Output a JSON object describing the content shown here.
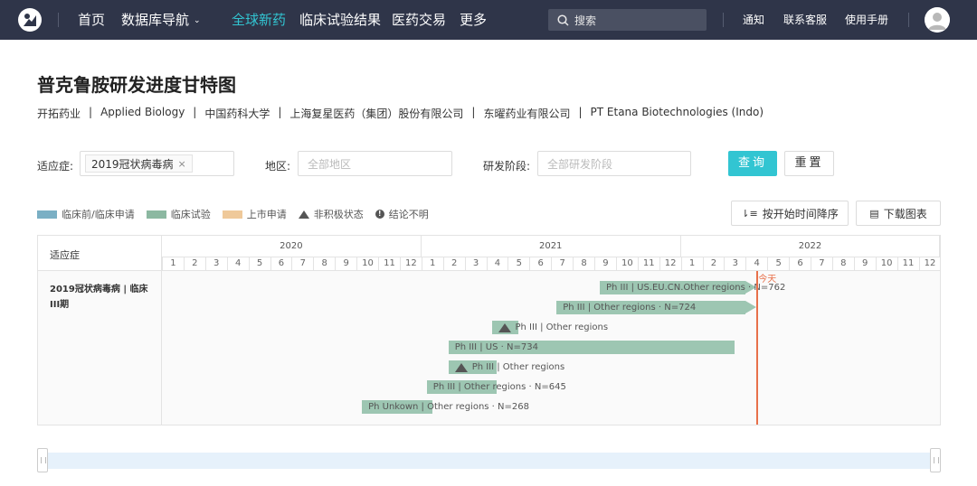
{
  "nav": {
    "logo": "brand-logo",
    "items": [
      {
        "label": "首页"
      },
      {
        "label": "数据库导航",
        "caret": "⌄"
      },
      {
        "label": "全球新药",
        "active": true
      },
      {
        "label": "临床试验结果"
      },
      {
        "label": "医药交易"
      },
      {
        "label": "更多"
      }
    ],
    "search_placeholder": "搜索",
    "right": [
      "通知",
      "联系客服",
      "使用手册"
    ]
  },
  "page": {
    "title": "普克鲁胺研发进度甘特图",
    "companies": [
      "开拓药业",
      "Applied Biology",
      "中国药科大学",
      "上海复星医药（集团）股份有限公司",
      "东曜药业有限公司",
      "PT Etana Biotechnologies (Indo)"
    ]
  },
  "filters": {
    "indication_label": "适应症:",
    "indication_tag": "2019冠状病毒病",
    "indication_tag_close": "×",
    "region_label": "地区:",
    "region_placeholder": "全部地区",
    "stage_label": "研发阶段:",
    "stage_placeholder": "全部研发阶段",
    "query": "查询",
    "reset": "重置"
  },
  "legend": [
    {
      "label": "临床前/临床申请",
      "color": "#7aafc4"
    },
    {
      "label": "临床试验",
      "color": "#8cb8a1"
    },
    {
      "label": "上市申请",
      "color": "#efc99a"
    },
    {
      "label": "非积极状态",
      "icon": "triangle-icon"
    },
    {
      "label": "结论不明",
      "icon": "info-icon"
    }
  ],
  "actions": {
    "sort": "按开始时间降序",
    "download": "下载图表"
  },
  "chart_data": {
    "type": "gantt",
    "row_header": "适应症",
    "row_label": "2019冠状病毒病 | 临床III期",
    "years": [
      "2020",
      "2021",
      "2022"
    ],
    "months": [
      "1",
      "2",
      "3",
      "4",
      "5",
      "6",
      "7",
      "8",
      "9",
      "10",
      "11",
      "12"
    ],
    "today_label": "今天",
    "today": "2022-04",
    "bars": [
      {
        "label": "Ph III | US.EU.CN.Other regions · N=762",
        "start": "2021-09",
        "end": "2022-04",
        "arrow": true,
        "inactive": false
      },
      {
        "label": "Ph III | Other regions · N=724",
        "start": "2021-07",
        "end": "2022-04",
        "arrow": true,
        "inactive": false
      },
      {
        "label": "Ph III | Other regions",
        "start": "2021-04",
        "end": "2021-05",
        "arrow": false,
        "inactive": true
      },
      {
        "label": "Ph III | US · N=734",
        "start": "2021-02",
        "end": "2022-03",
        "arrow": false,
        "inactive": false
      },
      {
        "label": "Ph III | Other regions",
        "start": "2021-02",
        "end": "2021-04",
        "arrow": false,
        "inactive": true
      },
      {
        "label": "Ph III | Other regions · N=645",
        "start": "2021-01",
        "end": "2021-04",
        "arrow": false,
        "inactive": false
      },
      {
        "label": "Ph Unkown | Other regions · N=268",
        "start": "2020-10",
        "end": "2021-01",
        "arrow": false,
        "inactive": false
      }
    ]
  }
}
